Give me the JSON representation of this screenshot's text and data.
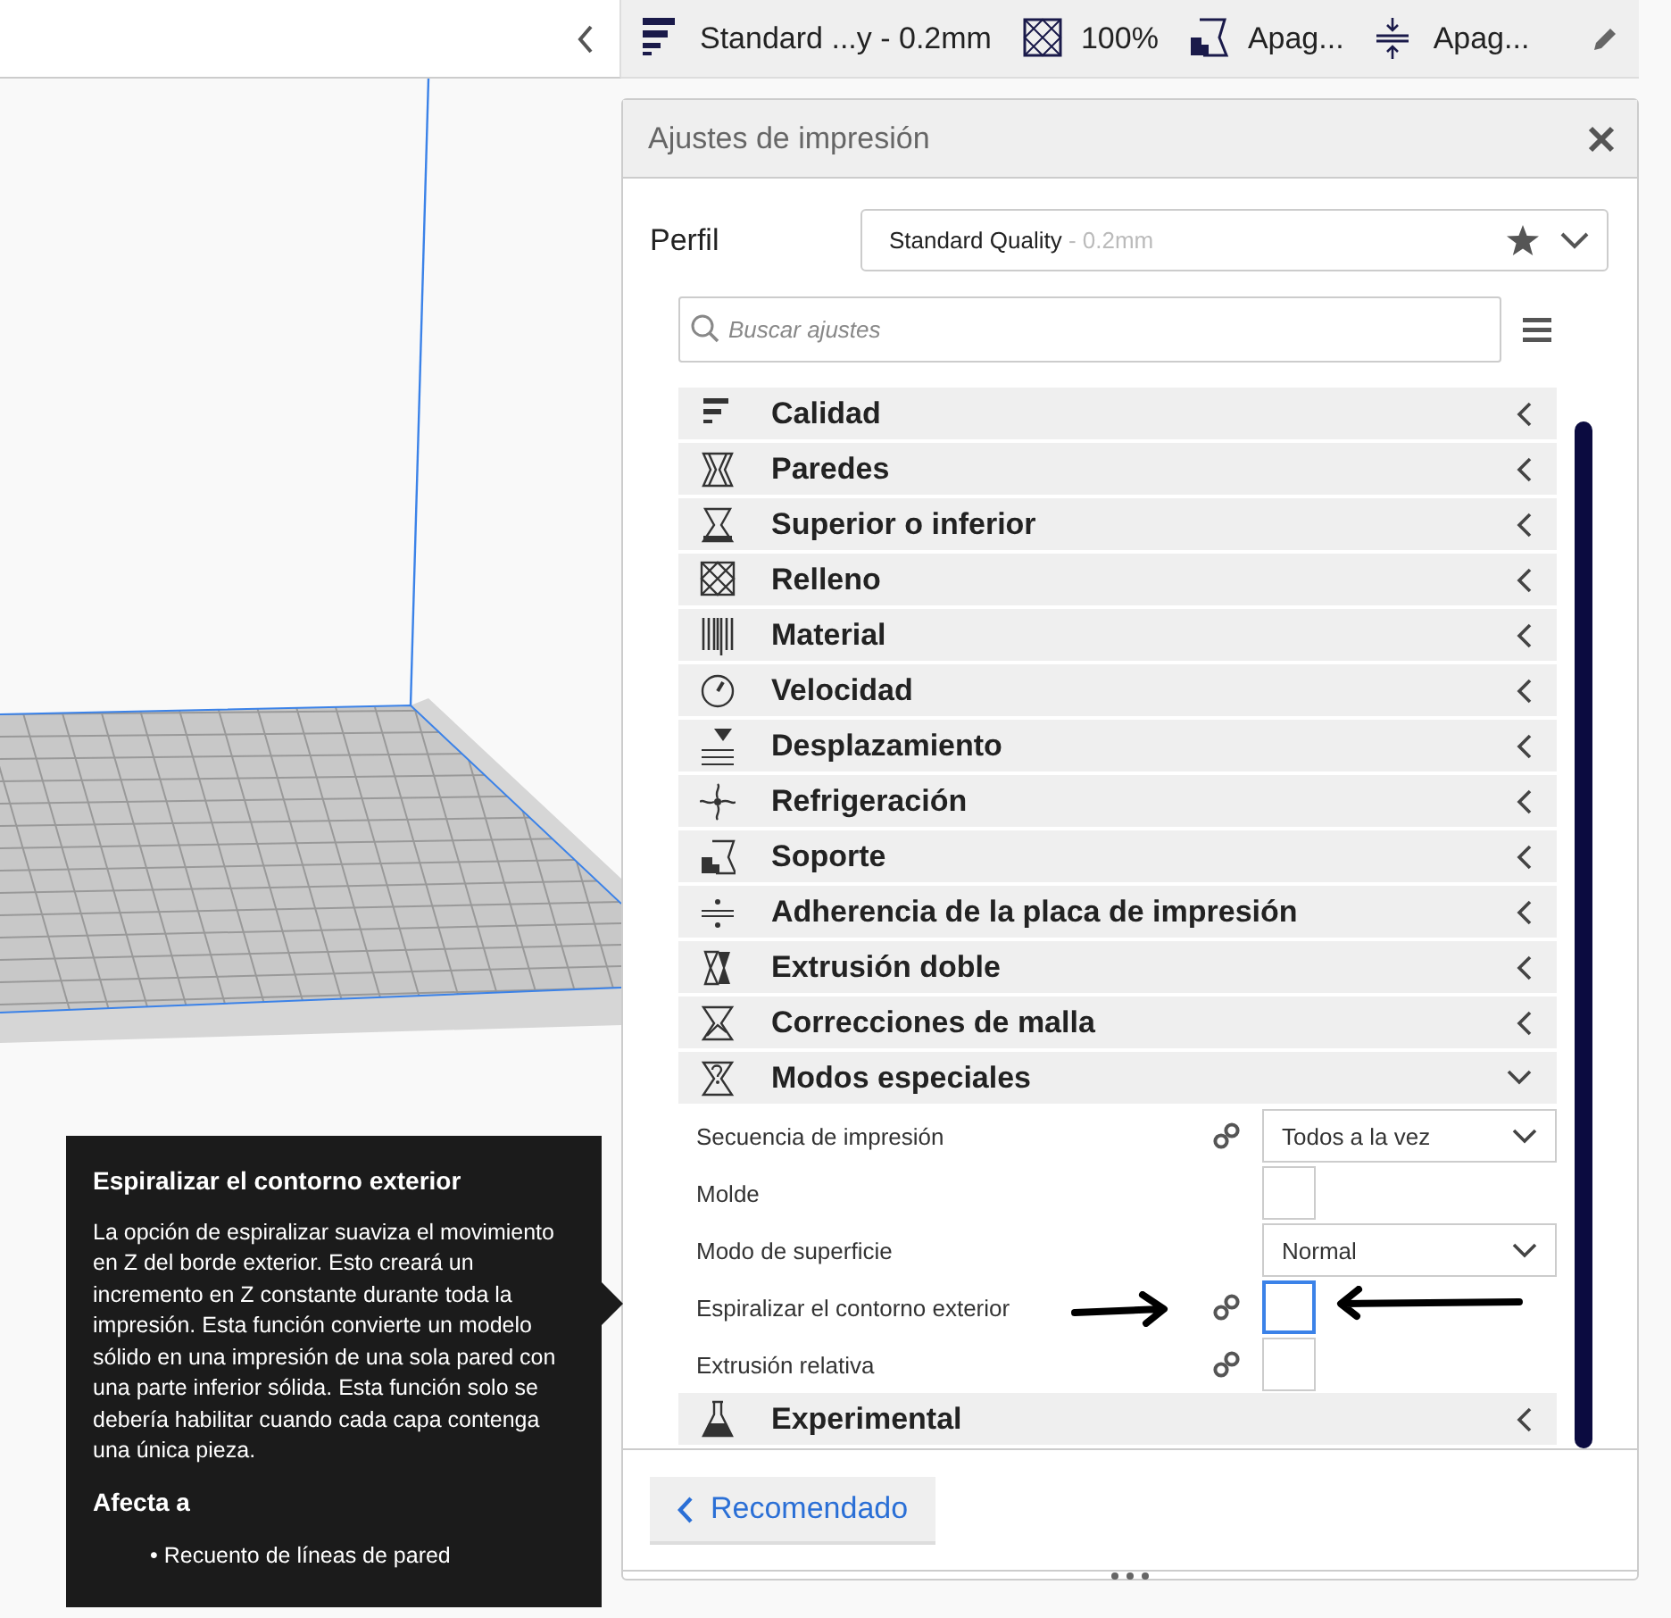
{
  "summary_bar": {
    "items": [
      {
        "kind": "profile",
        "text": "Standard ...y - 0.2mm"
      },
      {
        "kind": "infill",
        "text": "100%"
      },
      {
        "kind": "support",
        "text": "Apag..."
      },
      {
        "kind": "adhesion",
        "text": "Apag..."
      }
    ]
  },
  "print_settings": {
    "title": "Ajustes de impresión",
    "profile_label": "Perfil",
    "profile": {
      "name": "Standard Quality",
      "suffix": " - 0.2mm"
    },
    "search": {
      "placeholder": "Buscar ajustes"
    },
    "categories": [
      {
        "label": "Calidad",
        "expanded": false
      },
      {
        "label": "Paredes",
        "expanded": false
      },
      {
        "label": "Superior o inferior",
        "expanded": false
      },
      {
        "label": "Relleno",
        "expanded": false
      },
      {
        "label": "Material",
        "expanded": false
      },
      {
        "label": "Velocidad",
        "expanded": false
      },
      {
        "label": "Desplazamiento",
        "expanded": false
      },
      {
        "label": "Refrigeración",
        "expanded": false
      },
      {
        "label": "Soporte",
        "expanded": false
      },
      {
        "label": "Adherencia de la placa de impresión",
        "expanded": false
      },
      {
        "label": "Extrusión doble",
        "expanded": false
      },
      {
        "label": "Correcciones de malla",
        "expanded": false
      },
      {
        "label": "Modos especiales",
        "expanded": true,
        "settings": [
          {
            "kind": "dropdown",
            "label": "Secuencia de impresión",
            "linked": true,
            "value": "Todos a la vez"
          },
          {
            "kind": "checkbox",
            "label": "Molde",
            "linked": false,
            "checked": false,
            "focused": false
          },
          {
            "kind": "dropdown",
            "label": "Modo de superficie",
            "linked": false,
            "value": "Normal"
          },
          {
            "kind": "checkbox",
            "label": "Espiralizar el contorno exterior",
            "linked": true,
            "checked": false,
            "focused": true
          },
          {
            "kind": "checkbox",
            "label": "Extrusión relativa",
            "linked": true,
            "checked": false,
            "focused": false
          }
        ]
      },
      {
        "label": "Experimental",
        "expanded": false
      }
    ],
    "recommended_button": "Recomendado"
  },
  "tooltip": {
    "title": "Espiralizar el contorno exterior",
    "body": "La opción de espiralizar suaviza el movimiento en Z del borde exterior. Esto creará un incremento en Z constante durante toda la impresión. Esta función convierte un modelo sólido en una impresión de una sola pared con una parte inferior sólida. Esta función solo se debería habilitar cuando cada capa contenga una única pieza.",
    "affects_title": "Afecta a",
    "affects": [
      "• Recuento de líneas de pared"
    ]
  }
}
